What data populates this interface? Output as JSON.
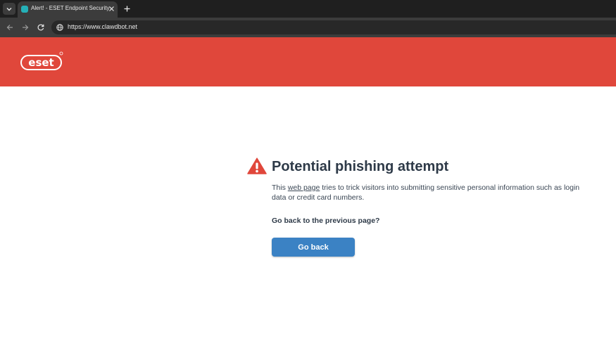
{
  "browser": {
    "tab_title": "Alert! - ESET Endpoint Security",
    "url": "https://www.clawdbot.net",
    "icons": {
      "tab_menu": "chevron-down-icon",
      "favicon": "eset-favicon-icon",
      "close": "close-icon",
      "new_tab": "plus-icon",
      "back": "arrow-left-icon",
      "forward": "arrow-right-icon",
      "reload": "reload-icon",
      "site_info": "globe-icon"
    }
  },
  "header": {
    "logo_text": "eset",
    "background_color": "#e0473b"
  },
  "alert": {
    "icon": "warning-triangle-icon",
    "icon_color": "#e0473b",
    "title": "Potential phishing attempt",
    "description_prefix": "This ",
    "description_link": "web page",
    "description_suffix": " tries to trick visitors into submitting sensitive personal information such as login data or credit card numbers.",
    "question": "Go back to the previous page?",
    "button_label": "Go back",
    "button_color": "#3b82c4"
  }
}
